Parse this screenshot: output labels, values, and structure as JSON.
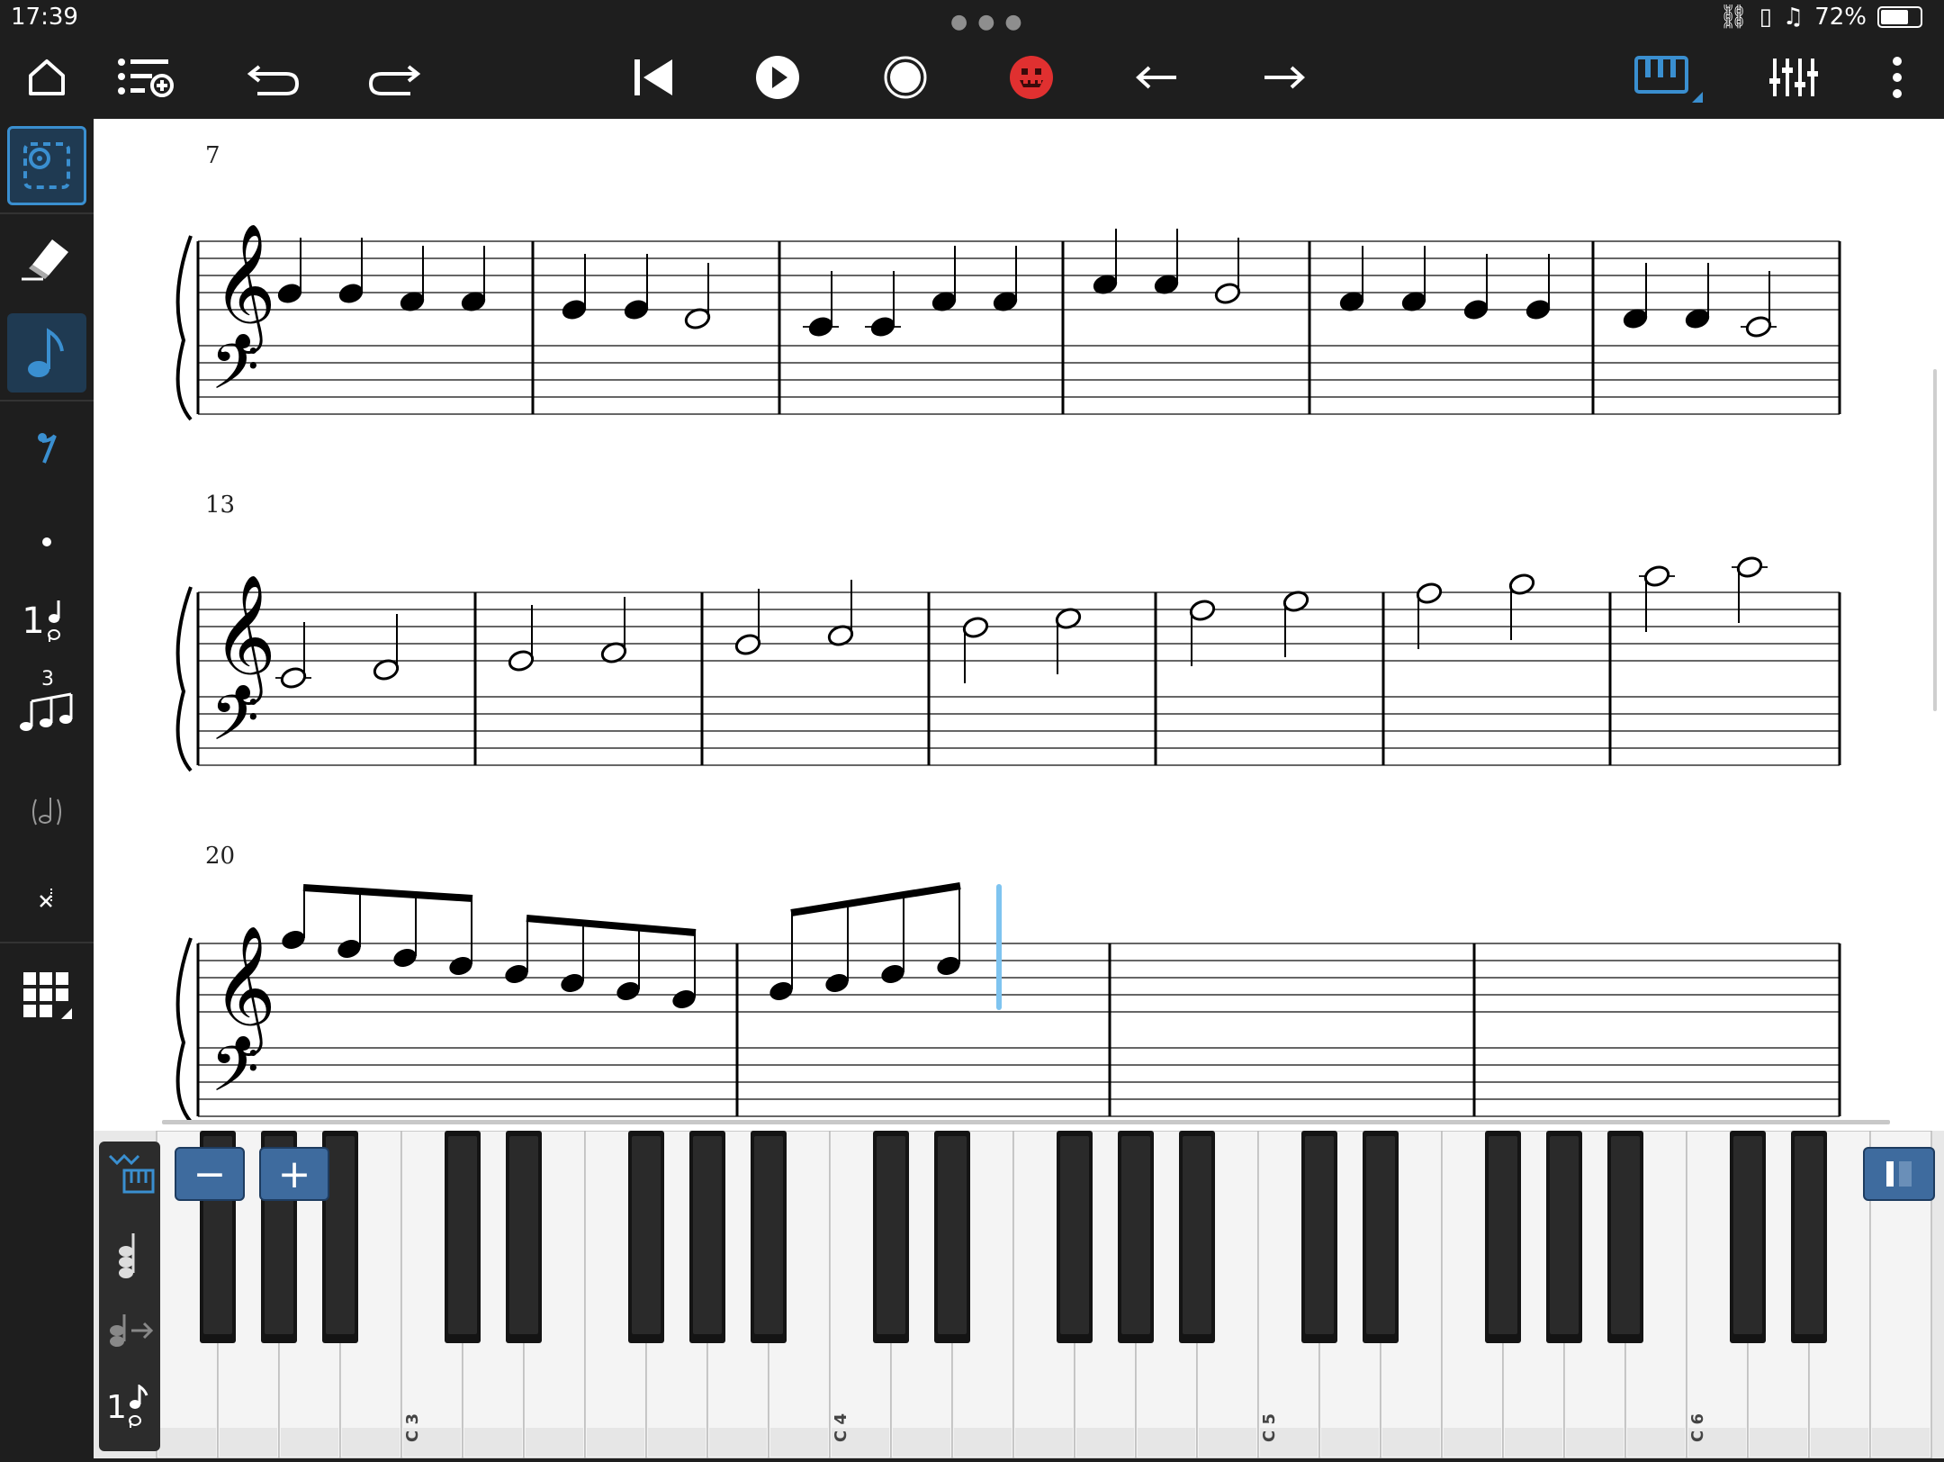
{
  "status_bar": {
    "time": "17:39",
    "battery_percent": "72%"
  },
  "toolbar": {
    "items": [
      "home-icon",
      "add-track-icon",
      "undo-icon",
      "redo-icon",
      "skip-to-start-icon",
      "play-icon",
      "record-icon",
      "metronome-face-icon",
      "arrow-left-icon",
      "arrow-right-icon",
      "piano-keyboard-icon",
      "mixer-icon",
      "more-icon"
    ]
  },
  "left_toolbar": {
    "items": [
      "selection-tool-icon",
      "eraser-tool-icon",
      "note-input-icon",
      "rest-icon",
      "dot-icon",
      "voice-icon",
      "triplet-icon",
      "tie-icon",
      "cross-notehead-icon",
      "palette-grid-icon"
    ],
    "triplet_number": "3",
    "voice_number": "1"
  },
  "score": {
    "systems": [
      {
        "measure_number": "7"
      },
      {
        "measure_number": "13"
      },
      {
        "measure_number": "20"
      }
    ]
  },
  "keyboard": {
    "octave_labels": [
      "C 3",
      "C 4",
      "C 5",
      "C 6"
    ],
    "zoom_out_label": "−",
    "zoom_in_label": "+",
    "voice_number": "1"
  },
  "colors": {
    "accent": "#3a8fd0",
    "cursor": "#7fc4f0",
    "record_red": "#e03030"
  }
}
